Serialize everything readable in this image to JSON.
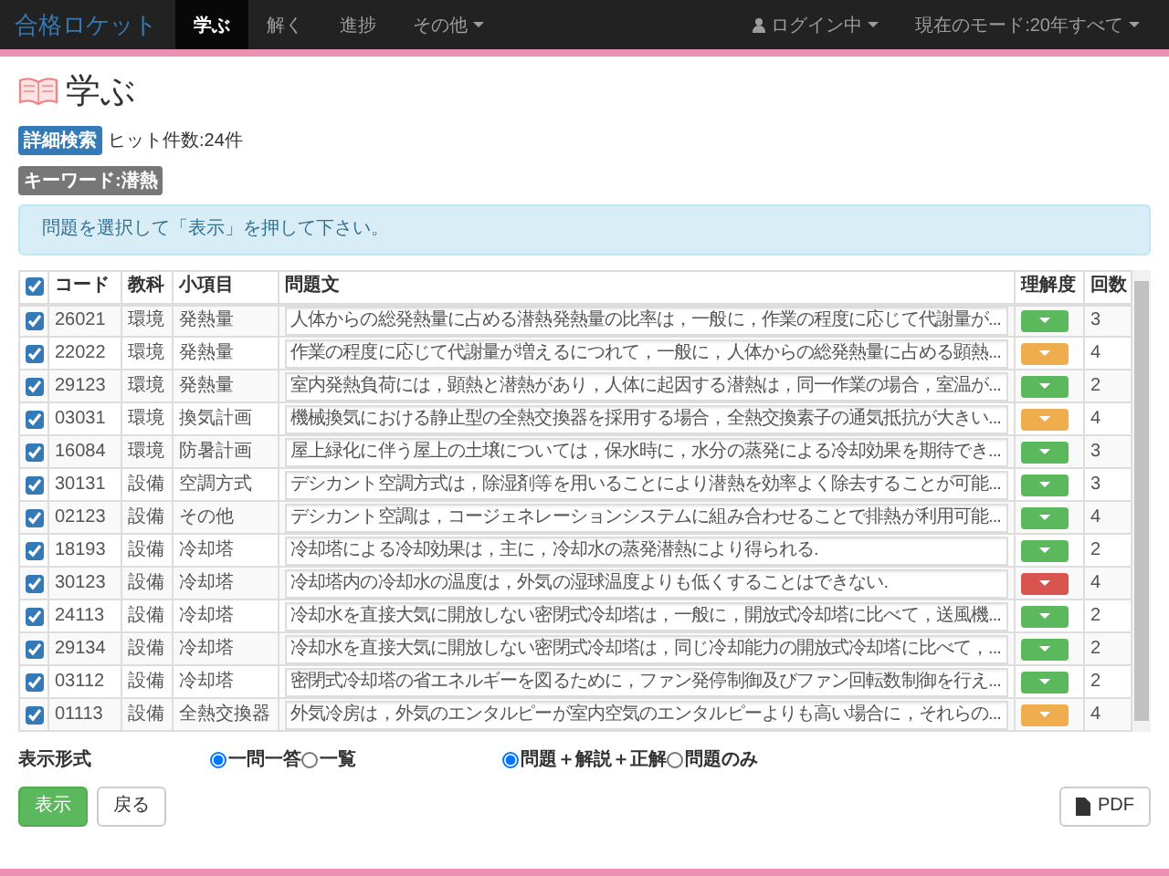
{
  "navbar": {
    "brand": "合格ロケット",
    "items": [
      {
        "label": "学ぶ",
        "selected": true,
        "dropdown": false
      },
      {
        "label": "解く",
        "selected": false,
        "dropdown": false
      },
      {
        "label": "進捗",
        "selected": false,
        "dropdown": false
      },
      {
        "label": "その他",
        "selected": false,
        "dropdown": true
      }
    ],
    "right": [
      {
        "label": "ログイン中",
        "kind": "user"
      },
      {
        "label": "現在のモード:20年すべて",
        "kind": "mode"
      }
    ]
  },
  "page_title": "学ぶ",
  "badges": [
    {
      "label": "詳細検索",
      "kind": "search"
    },
    {
      "label": "キーワード:潜熱",
      "kind": "keyword"
    }
  ],
  "hit_count": "ヒット件数:24件",
  "alert": "問題を選択して「表示」を押して下さい。",
  "table": {
    "select_all": true,
    "columns": [
      "コード",
      "教科",
      "小項目",
      "問題文",
      "理解度",
      "回数"
    ],
    "rows": [
      {
        "checked": true,
        "code": "26021",
        "subject": "環境",
        "item": "発熱量",
        "question": "人体からの総発熱量に占める潜熱発熱量の比率は，一般に，作業の程度に応じて代謝量が...",
        "color": "#5cb85c",
        "count": "3"
      },
      {
        "checked": true,
        "code": "22022",
        "subject": "環境",
        "item": "発熱量",
        "question": "作業の程度に応じて代謝量が増えるにつれて，一般に，人体からの総発熱量に占める顕熱...",
        "color": "#f0ad4e",
        "count": "4"
      },
      {
        "checked": true,
        "code": "29123",
        "subject": "環境",
        "item": "発熱量",
        "question": "室内発熱負荷には，顕熱と潜熱があり，人体に起因する潜熱は，同一作業の場合，室温が...",
        "color": "#5cb85c",
        "count": "2"
      },
      {
        "checked": true,
        "code": "03031",
        "subject": "環境",
        "item": "換気計画",
        "question": "機械換気における静止型の全熱交換器を採用する場合，全熱交換素子の通気抵抗が大きい...",
        "color": "#f0ad4e",
        "count": "4"
      },
      {
        "checked": true,
        "code": "16084",
        "subject": "環境",
        "item": "防暑計画",
        "question": "屋上緑化に伴う屋上の土壌については，保水時に，水分の蒸発による冷却効果を期待でき...",
        "color": "#5cb85c",
        "count": "3"
      },
      {
        "checked": true,
        "code": "30131",
        "subject": "設備",
        "item": "空調方式",
        "question": "デシカント空調方式は，除湿剤等を用いることにより潜熱を効率よく除去することが可能...",
        "color": "#5cb85c",
        "count": "3"
      },
      {
        "checked": true,
        "code": "02123",
        "subject": "設備",
        "item": "その他",
        "question": "デシカント空調は，コージェネレーションシステムに組み合わせることで排熱が利用可能...",
        "color": "#5cb85c",
        "count": "4"
      },
      {
        "checked": true,
        "code": "18193",
        "subject": "設備",
        "item": "冷却塔",
        "question": "冷却塔による冷却効果は，主に，冷却水の蒸発潜熱により得られる.",
        "color": "#5cb85c",
        "count": "2"
      },
      {
        "checked": true,
        "code": "30123",
        "subject": "設備",
        "item": "冷却塔",
        "question": "冷却塔内の冷却水の温度は，外気の湿球温度よりも低くすることはできない.",
        "color": "#d9534f",
        "count": "4"
      },
      {
        "checked": true,
        "code": "24113",
        "subject": "設備",
        "item": "冷却塔",
        "question": "冷却水を直接大気に開放しない密閉式冷却塔は，一般に，開放式冷却塔に比べて，送風機...",
        "color": "#5cb85c",
        "count": "2"
      },
      {
        "checked": true,
        "code": "29134",
        "subject": "設備",
        "item": "冷却塔",
        "question": "冷却水を直接大気に開放しない密閉式冷却塔は，同じ冷却能力の開放式冷却塔に比べて，...",
        "color": "#5cb85c",
        "count": "2"
      },
      {
        "checked": true,
        "code": "03112",
        "subject": "設備",
        "item": "冷却塔",
        "question": "密閉式冷却塔の省エネルギーを図るために，ファン発停制御及びファン回転数制御を行え...",
        "color": "#5cb85c",
        "count": "2"
      },
      {
        "checked": true,
        "code": "01113",
        "subject": "設備",
        "item": "全熱交換器",
        "question": "外気冷房は，外気のエンタルピーが室内空気のエンタルピーよりも高い場合に，それらの...",
        "color": "#f0ad4e",
        "count": "4"
      }
    ]
  },
  "display_format": {
    "label": "表示形式",
    "groups": [
      [
        {
          "label": "一問一答",
          "selected": true
        },
        {
          "label": "一覧",
          "selected": false
        }
      ],
      [
        {
          "label": "問題＋解説＋正解",
          "selected": true
        },
        {
          "label": "問題のみ",
          "selected": false
        }
      ]
    ]
  },
  "buttons": [
    {
      "label": "表示",
      "kind": "primary"
    },
    {
      "label": "戻る",
      "kind": "default"
    },
    {
      "label": "PDF",
      "kind": "pdf"
    }
  ]
}
